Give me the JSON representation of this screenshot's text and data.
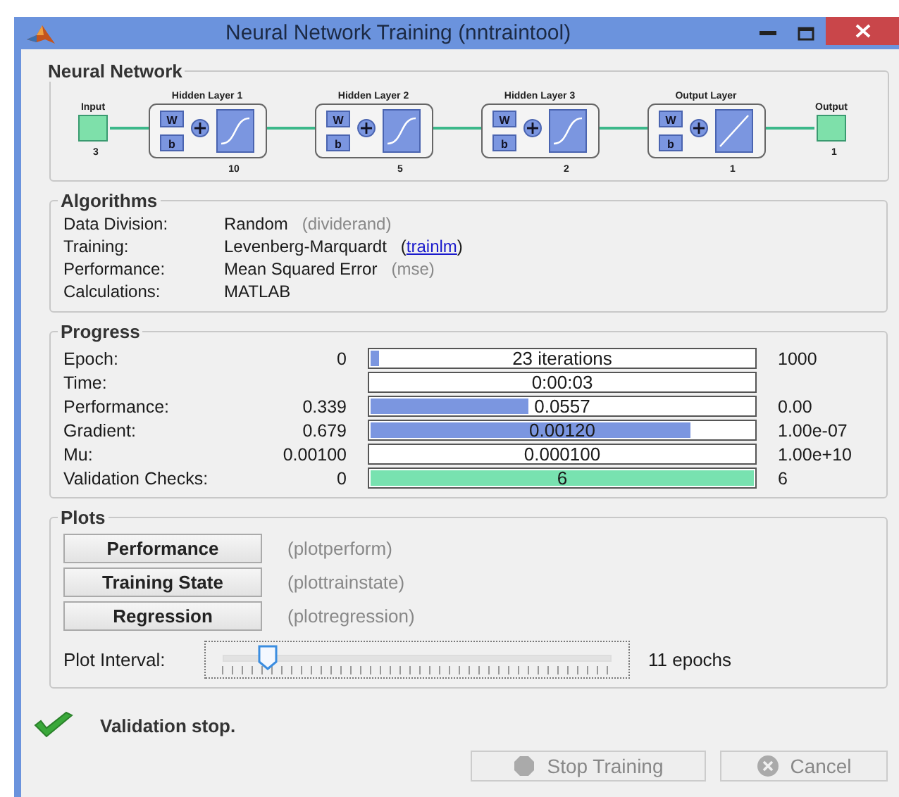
{
  "window": {
    "title": "Neural Network Training (nntraintool)"
  },
  "neural_network": {
    "title": "Neural Network",
    "input": {
      "label": "Input",
      "size": "3"
    },
    "layers": [
      {
        "title": "Hidden Layer 1",
        "weight": "W",
        "bias": "b",
        "kind": "sigmoid",
        "size": "10"
      },
      {
        "title": "Hidden Layer 2",
        "weight": "W",
        "bias": "b",
        "kind": "sigmoid",
        "size": "5"
      },
      {
        "title": "Hidden Layer 3",
        "weight": "W",
        "bias": "b",
        "kind": "sigmoid",
        "size": "2"
      },
      {
        "title": "Output Layer",
        "weight": "W",
        "bias": "b",
        "kind": "linear",
        "size": "1"
      }
    ],
    "output": {
      "label": "Output",
      "size": "1"
    }
  },
  "algorithms": {
    "title": "Algorithms",
    "rows": [
      {
        "label": "Data Division:",
        "value": "Random",
        "kind": "plain",
        "function": "(dividerand)"
      },
      {
        "label": "Training:",
        "value": "Levenberg-Marquardt",
        "kind": "link",
        "function_prefix": "(",
        "link": "trainlm",
        "function_suffix": ")"
      },
      {
        "label": "Performance:",
        "value": "Mean Squared Error",
        "kind": "plain",
        "function": "(mse)"
      },
      {
        "label": "Calculations:",
        "value": "MATLAB",
        "kind": "none"
      }
    ]
  },
  "progress": {
    "title": "Progress",
    "rows": [
      {
        "label": "Epoch:",
        "start": "0",
        "bar_text": "23 iterations",
        "kind": "bar",
        "level": 0.023,
        "end": "1000"
      },
      {
        "label": "Time:",
        "bar_text": "0:00:03",
        "kind": "text"
      },
      {
        "label": "Performance:",
        "start": "0.339",
        "bar_text": "0.0557",
        "kind": "bar",
        "level": 0.41,
        "end": "0.00"
      },
      {
        "label": "Gradient:",
        "start": "0.679",
        "bar_text": "0.00120",
        "kind": "bar",
        "level": 0.83,
        "end": "1.00e-07"
      },
      {
        "label": "Mu:",
        "start": "0.00100",
        "bar_text": "0.000100",
        "kind": "text",
        "end": "1.00e+10"
      },
      {
        "label": "Validation Checks:",
        "start": "0",
        "bar_text": "6",
        "kind": "check",
        "level": 1,
        "end": "6"
      }
    ]
  },
  "plots": {
    "title": "Plots",
    "buttons": [
      {
        "label": "Performance",
        "function": "(plotperform)"
      },
      {
        "label": "Training State",
        "function": "(plottrainstate)"
      },
      {
        "label": "Regression",
        "function": "(plotregression)"
      }
    ],
    "interval": {
      "label": "Plot Interval:",
      "level": 0.1,
      "reading": "11 epochs"
    }
  },
  "status": {
    "message": "Validation stop.",
    "kind": "success"
  },
  "buttons": [
    {
      "label": "Stop Training",
      "kind": "stop",
      "disabled": true
    },
    {
      "label": "Cancel",
      "kind": "cancel",
      "disabled": true
    }
  ]
}
